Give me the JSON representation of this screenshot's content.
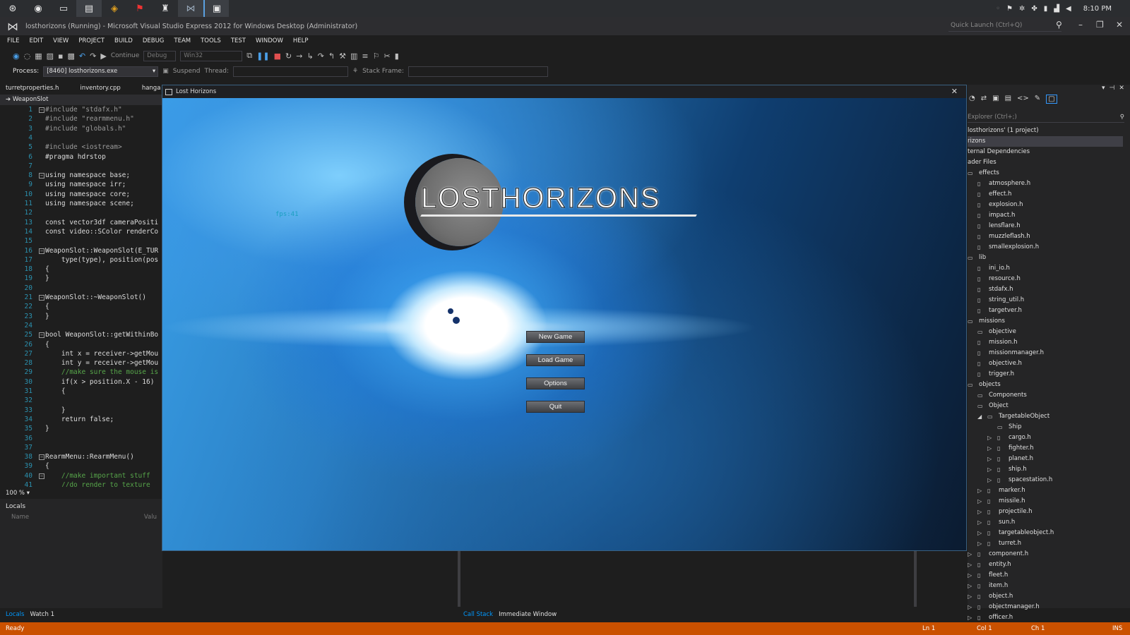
{
  "taskbar": {
    "icons": [
      "steam-icon",
      "chrome-icon",
      "explorer-icon",
      "files-icon",
      "paint-icon",
      "acrobat-icon",
      "tool-icon",
      "visual-studio-icon",
      "game-window-icon"
    ],
    "clock": "8:10 PM"
  },
  "vs": {
    "title": "losthorizons (Running) - Microsoft Visual Studio Express 2012 for Windows Desktop (Administrator)",
    "quick_launch": "Quick Launch (Ctrl+Q)",
    "menu": [
      "FILE",
      "EDIT",
      "VIEW",
      "PROJECT",
      "BUILD",
      "DEBUG",
      "TEAM",
      "TOOLS",
      "TEST",
      "WINDOW",
      "HELP"
    ],
    "toolbar": {
      "continue": "Continue",
      "config": "Debug",
      "platform": "Win32"
    },
    "toolbar2": {
      "process_label": "Process:",
      "process": "[8460] losthorizons.exe",
      "suspend": "Suspend",
      "thread": "Thread:",
      "stack_frame": "Stack Frame:"
    },
    "tabs": [
      "turretproperties.h",
      "inventory.cpp",
      "hanga"
    ],
    "nav": "WeaponSlot",
    "code": [
      {
        "n": "1",
        "t": "#include \"stdafx.h\""
      },
      {
        "n": "2",
        "t": "#include \"rearmmenu.h\""
      },
      {
        "n": "3",
        "t": "#include \"globals.h\""
      },
      {
        "n": "4",
        "t": ""
      },
      {
        "n": "5",
        "t": "#include <iostream>"
      },
      {
        "n": "6",
        "t": "#pragma hdrstop"
      },
      {
        "n": "7",
        "t": ""
      },
      {
        "n": "8",
        "t": "using namespace base;"
      },
      {
        "n": "9",
        "t": "using namespace irr;"
      },
      {
        "n": "10",
        "t": "using namespace core;"
      },
      {
        "n": "11",
        "t": "using namespace scene;"
      },
      {
        "n": "12",
        "t": ""
      },
      {
        "n": "13",
        "t": "const vector3df cameraPositi"
      },
      {
        "n": "14",
        "t": "const video::SColor renderCo"
      },
      {
        "n": "15",
        "t": ""
      },
      {
        "n": "16",
        "t": "WeaponSlot::WeaponSlot(E_TUR"
      },
      {
        "n": "17",
        "t": "    type(type), position(pos"
      },
      {
        "n": "18",
        "t": "{"
      },
      {
        "n": "19",
        "t": "}"
      },
      {
        "n": "20",
        "t": ""
      },
      {
        "n": "21",
        "t": "WeaponSlot::~WeaponSlot()"
      },
      {
        "n": "22",
        "t": "{"
      },
      {
        "n": "23",
        "t": "}"
      },
      {
        "n": "24",
        "t": ""
      },
      {
        "n": "25",
        "t": "bool WeaponSlot::getWithinBo"
      },
      {
        "n": "26",
        "t": "{"
      },
      {
        "n": "27",
        "t": "    int x = receiver->getMou"
      },
      {
        "n": "28",
        "t": "    int y = receiver->getMou"
      },
      {
        "n": "29",
        "t": "    //make sure the mouse is"
      },
      {
        "n": "30",
        "t": "    if(x > position.X - 16)"
      },
      {
        "n": "31",
        "t": "    {"
      },
      {
        "n": "32",
        "t": ""
      },
      {
        "n": "33",
        "t": "    }"
      },
      {
        "n": "34",
        "t": "    return false;"
      },
      {
        "n": "35",
        "t": "}"
      },
      {
        "n": "36",
        "t": ""
      },
      {
        "n": "37",
        "t": ""
      },
      {
        "n": "38",
        "t": "RearmMenu::RearmMenu()"
      },
      {
        "n": "39",
        "t": "{"
      },
      {
        "n": "40",
        "t": "    //make important stuff"
      },
      {
        "n": "41",
        "t": "    //do render to texture"
      }
    ],
    "zoom": "100 %",
    "locals": {
      "title": "Locals",
      "name_col": "Name",
      "value_col": "Valu"
    },
    "bottom_tabs_left": [
      "Locals",
      "Watch 1"
    ],
    "bottom_tabs_right": [
      "Call Stack",
      "Immediate Window"
    ],
    "status": {
      "left": "Ready",
      "ln": "Ln 1",
      "col": "Col 1",
      "ch": "Ch 1",
      "mode": "INS"
    }
  },
  "game": {
    "title": "Lost Horizons",
    "logo": "LOSTHORIZONS",
    "fps": "fps:41",
    "buttons": [
      "New Game",
      "Load Game",
      "Options",
      "Quit"
    ]
  },
  "solution": {
    "search": "Explorer (Ctrl+;)",
    "tree": [
      {
        "l": "losthorizons' (1 project)",
        "d": 0,
        "t": "none"
      },
      {
        "l": "rizons",
        "d": 0,
        "t": "none",
        "sel": true
      },
      {
        "l": "ternal Dependencies",
        "d": 0,
        "t": "none"
      },
      {
        "l": "ader Files",
        "d": 0,
        "t": "none"
      },
      {
        "l": "effects",
        "d": 0,
        "t": "folder"
      },
      {
        "l": "atmosphere.h",
        "d": 1,
        "t": "file"
      },
      {
        "l": "effect.h",
        "d": 1,
        "t": "file"
      },
      {
        "l": "explosion.h",
        "d": 1,
        "t": "file"
      },
      {
        "l": "impact.h",
        "d": 1,
        "t": "file"
      },
      {
        "l": "lensflare.h",
        "d": 1,
        "t": "file"
      },
      {
        "l": "muzzleflash.h",
        "d": 1,
        "t": "file"
      },
      {
        "l": "smallexplosion.h",
        "d": 1,
        "t": "file"
      },
      {
        "l": "lib",
        "d": 0,
        "t": "folder"
      },
      {
        "l": "ini_io.h",
        "d": 1,
        "t": "file"
      },
      {
        "l": "resource.h",
        "d": 1,
        "t": "file"
      },
      {
        "l": "stdafx.h",
        "d": 1,
        "t": "file"
      },
      {
        "l": "string_util.h",
        "d": 1,
        "t": "file"
      },
      {
        "l": "targetver.h",
        "d": 1,
        "t": "file"
      },
      {
        "l": "missions",
        "d": 0,
        "t": "folder"
      },
      {
        "l": "objective",
        "d": 1,
        "t": "folder"
      },
      {
        "l": "mission.h",
        "d": 1,
        "t": "file"
      },
      {
        "l": "missionmanager.h",
        "d": 1,
        "t": "file"
      },
      {
        "l": "objective.h",
        "d": 1,
        "t": "file"
      },
      {
        "l": "trigger.h",
        "d": 1,
        "t": "file"
      },
      {
        "l": "objects",
        "d": 0,
        "t": "folder"
      },
      {
        "l": "Components",
        "d": 1,
        "t": "folder"
      },
      {
        "l": "Object",
        "d": 1,
        "t": "folder"
      },
      {
        "l": "TargetableObject",
        "d": 2,
        "t": "folder",
        "arr": "open"
      },
      {
        "l": "Ship",
        "d": 3,
        "t": "folder"
      },
      {
        "l": "cargo.h",
        "d": 3,
        "t": "file",
        "arr": "closed"
      },
      {
        "l": "fighter.h",
        "d": 3,
        "t": "file",
        "arr": "closed"
      },
      {
        "l": "planet.h",
        "d": 3,
        "t": "file",
        "arr": "closed"
      },
      {
        "l": "ship.h",
        "d": 3,
        "t": "file",
        "arr": "closed"
      },
      {
        "l": "spacestation.h",
        "d": 3,
        "t": "file",
        "arr": "closed"
      },
      {
        "l": "marker.h",
        "d": 2,
        "t": "file",
        "arr": "closed"
      },
      {
        "l": "missile.h",
        "d": 2,
        "t": "file",
        "arr": "closed"
      },
      {
        "l": "projectile.h",
        "d": 2,
        "t": "file",
        "arr": "closed"
      },
      {
        "l": "sun.h",
        "d": 2,
        "t": "file",
        "arr": "closed"
      },
      {
        "l": "targetableobject.h",
        "d": 2,
        "t": "file",
        "arr": "closed"
      },
      {
        "l": "turret.h",
        "d": 2,
        "t": "file",
        "arr": "closed"
      },
      {
        "l": "component.h",
        "d": 1,
        "t": "file",
        "arr": "closed"
      },
      {
        "l": "entity.h",
        "d": 1,
        "t": "file",
        "arr": "closed"
      },
      {
        "l": "fleet.h",
        "d": 1,
        "t": "file",
        "arr": "closed"
      },
      {
        "l": "item.h",
        "d": 1,
        "t": "file",
        "arr": "closed"
      },
      {
        "l": "object.h",
        "d": 1,
        "t": "file",
        "arr": "closed"
      },
      {
        "l": "objectmanager.h",
        "d": 1,
        "t": "file",
        "arr": "closed"
      },
      {
        "l": "officer.h",
        "d": 1,
        "t": "file",
        "arr": "closed"
      }
    ]
  }
}
